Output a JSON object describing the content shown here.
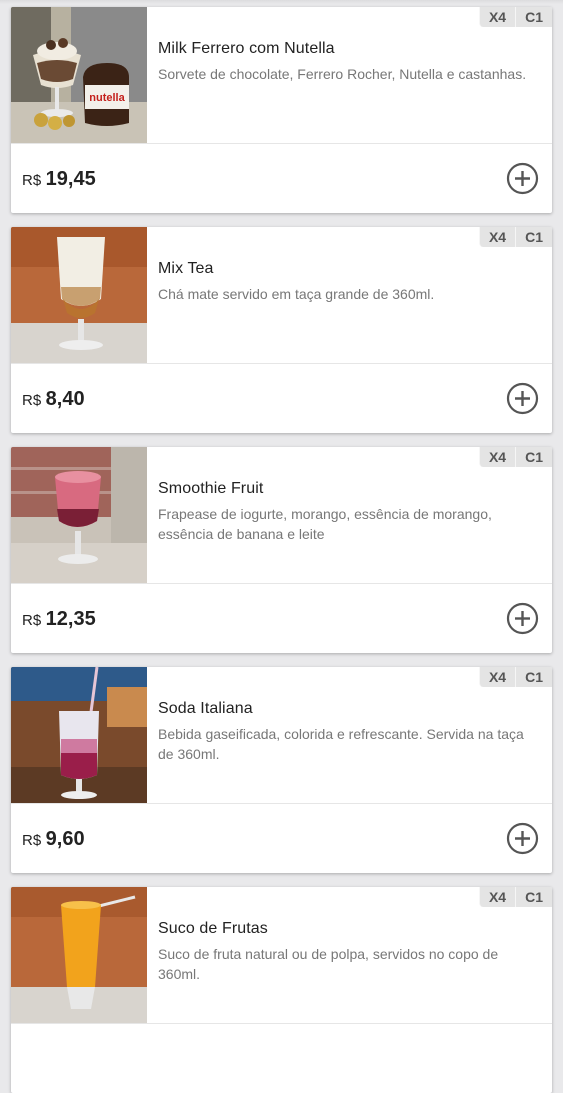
{
  "products": [
    {
      "name": "Milk Ferrero com Nutella",
      "description": "Sorvete de chocolate, Ferrero Rocher, Nutella e castanhas.",
      "currency": "R$",
      "price": "19,45",
      "tags": [
        "X4",
        "C1"
      ],
      "image_icon": "milkshake-nutella-photo",
      "image_label": "nutella"
    },
    {
      "name": "Mix Tea",
      "description": "Chá mate servido em taça grande de 360ml.",
      "currency": "R$",
      "price": "8,40",
      "tags": [
        "X4",
        "C1"
      ],
      "image_icon": "tea-glass-photo"
    },
    {
      "name": "Smoothie Fruit",
      "description": "Frapease de iogurte, morango, essência de morango, essência de banana e leite",
      "currency": "R$",
      "price": "12,35",
      "tags": [
        "X4",
        "C1"
      ],
      "image_icon": "smoothie-glass-photo"
    },
    {
      "name": "Soda Italiana",
      "description": "Bebida gaseificada, colorida e refrescante. Servida na taça de 360ml.",
      "currency": "R$",
      "price": "9,60",
      "tags": [
        "X4",
        "C1"
      ],
      "image_icon": "soda-glass-photo"
    },
    {
      "name": "Suco de Frutas",
      "description": "Suco de fruta natural ou de polpa, servidos no copo de 360ml.",
      "currency": "R$",
      "price": "",
      "tags": [
        "X4",
        "C1"
      ],
      "image_icon": "juice-glass-photo"
    }
  ],
  "colors": {
    "background": "#e9e9eb",
    "card": "#ffffff",
    "tag_bg": "#e4e4e4",
    "tag_text": "#555555",
    "name_text": "#222222",
    "desc_text": "#777777",
    "add_icon": "#555555"
  }
}
